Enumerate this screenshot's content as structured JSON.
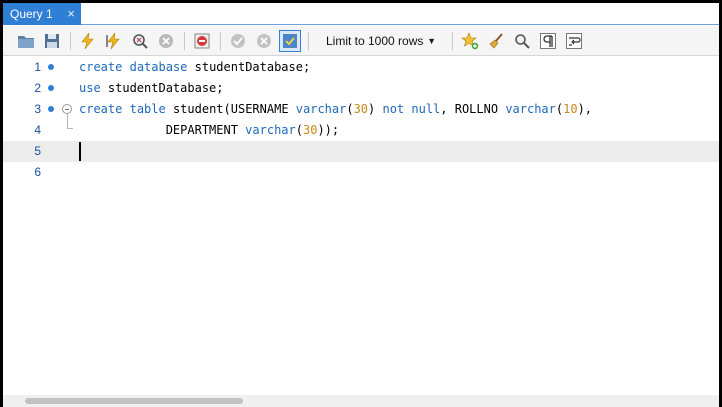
{
  "tabs": [
    {
      "label": "Query 1",
      "close": "×"
    }
  ],
  "toolbar": {
    "limit_select": {
      "value": "Limit to 1000 rows",
      "caret": "▼"
    },
    "icons": [
      "open-folder-icon",
      "save-icon",
      "execute-lightning-icon",
      "execute-current-icon",
      "explain-magnifier-icon",
      "stop-icon",
      "toggle-error-stop-icon",
      "commit-check-icon",
      "rollback-x-icon",
      "autocommit-toggle-icon",
      "add-snippet-star-icon",
      "beautify-broom-icon",
      "find-magnifier-icon",
      "invisible-chars-pilcrow-icon",
      "word-wrap-icon"
    ]
  },
  "editor": {
    "lines": [
      {
        "num": "1",
        "marker": true,
        "tokens": [
          {
            "t": "create",
            "c": "kw"
          },
          {
            "t": " "
          },
          {
            "t": "database",
            "c": "kw"
          },
          {
            "t": " studentDatabase;"
          }
        ]
      },
      {
        "num": "2",
        "marker": true,
        "tokens": [
          {
            "t": "use",
            "c": "kw"
          },
          {
            "t": " studentDatabase;"
          }
        ]
      },
      {
        "num": "3",
        "marker": true,
        "tokens": [
          {
            "t": "create",
            "c": "kw"
          },
          {
            "t": " "
          },
          {
            "t": "table",
            "c": "kw"
          },
          {
            "t": " student(USERNAME "
          },
          {
            "t": "varchar",
            "c": "kw"
          },
          {
            "t": "("
          },
          {
            "t": "30",
            "c": "num"
          },
          {
            "t": ") "
          },
          {
            "t": "not null",
            "c": "kw"
          },
          {
            "t": ", ROLLNO "
          },
          {
            "t": "varchar",
            "c": "kw"
          },
          {
            "t": "("
          },
          {
            "t": "10",
            "c": "num"
          },
          {
            "t": "),"
          }
        ]
      },
      {
        "num": "4",
        "marker": false,
        "tokens": [
          {
            "t": "            DEPARTMENT "
          },
          {
            "t": "varchar",
            "c": "kw"
          },
          {
            "t": "("
          },
          {
            "t": "30",
            "c": "num"
          },
          {
            "t": "));"
          }
        ]
      },
      {
        "num": "5",
        "marker": false,
        "current": true,
        "tokens": []
      },
      {
        "num": "6",
        "marker": false,
        "tokens": []
      }
    ]
  },
  "colors": {
    "tab_active": "#2f7fd4",
    "keyword": "#1f68b8",
    "number": "#c68a1a",
    "line_number": "#1b4e9b",
    "current_line": "#ececec"
  }
}
